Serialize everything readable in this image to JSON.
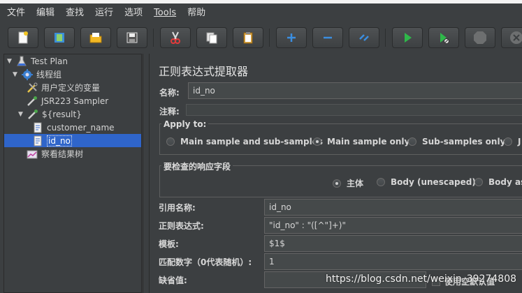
{
  "menu": [
    "文件",
    "编辑",
    "查找",
    "运行",
    "选项",
    "Tools",
    "帮助"
  ],
  "toolbar": {
    "buttons": [
      "new-icon",
      "templates-icon",
      "open-icon",
      "save-icon",
      "cut-icon",
      "copy-icon",
      "paste-icon",
      "expand-icon",
      "collapse-icon",
      "toggle-icon",
      "start-icon",
      "start-no-pause-icon",
      "stop-icon",
      "shutdown-icon"
    ]
  },
  "tree": {
    "test_plan": "Test Plan",
    "thread_group": "线程组",
    "user_vars": "用户定义的变量",
    "jsr223": "JSR223 Sampler",
    "result": "${result}",
    "customer_name": "customer_name",
    "id_no": "id_no",
    "view_results": "察看结果树"
  },
  "panel": {
    "title": "正则表达式提取器",
    "name_label": "名称:",
    "name_value": "id_no",
    "comment_label": "注释:",
    "comment_value": "",
    "apply_to": {
      "title": "Apply to:",
      "options": [
        "Main sample and sub-samples",
        "Main sample only",
        "Sub-samples only",
        "J"
      ],
      "selected": 1
    },
    "response_field": {
      "title": "要检查的响应字段",
      "options": [
        "主体",
        "Body (unescaped)",
        "Body as a"
      ],
      "selected": 0
    },
    "ref_name_label": "引用名称:",
    "ref_name_value": "id_no",
    "regex_label": "正则表达式:",
    "regex_value": "\"id_no\" : \"([^\"]+)\"",
    "template_label": "模板:",
    "template_value": "$1$",
    "match_no_label": "匹配数字（0代表随机）:",
    "match_no_value": "1",
    "default_label": "缺省值:",
    "default_value": "",
    "default_checkbox": "使用空默认值"
  },
  "watermark": "https://blog.csdn.net/weixin_39274808"
}
